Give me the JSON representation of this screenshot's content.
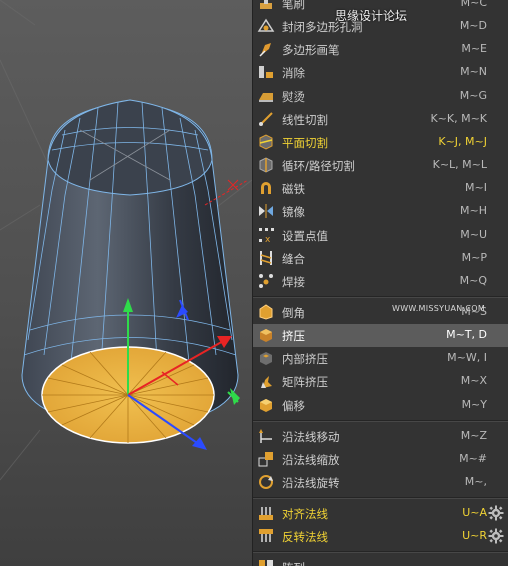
{
  "watermark": {
    "site_name": "思缘设计论坛",
    "url": "WWW.MISSYUAN.COM"
  },
  "menu_groups": [
    [
      {
        "icon": "brush-icon",
        "label": "笔刷",
        "shortcut": "M~C"
      },
      {
        "icon": "close-polygon-hole-icon",
        "label": "封闭多边形孔洞",
        "shortcut": "M~D"
      },
      {
        "icon": "polygon-pen-icon",
        "label": "多边形画笔",
        "shortcut": "M~E"
      },
      {
        "icon": "dissolve-icon",
        "label": "消除",
        "shortcut": "M~N"
      },
      {
        "icon": "iron-icon",
        "label": "熨烫",
        "shortcut": "M~G"
      },
      {
        "icon": "line-cut-icon",
        "label": "线性切割",
        "shortcut": "K~K, M~K"
      },
      {
        "icon": "plane-cut-icon",
        "label": "平面切割",
        "shortcut": "K~J, M~J",
        "yellow": true
      },
      {
        "icon": "loop-path-cut-icon",
        "label": "循环/路径切割",
        "shortcut": "K~L, M~L"
      },
      {
        "icon": "magnet-icon",
        "label": "磁铁",
        "shortcut": "M~I"
      },
      {
        "icon": "mirror-icon",
        "label": "镜像",
        "shortcut": "M~H"
      },
      {
        "icon": "set-point-value-icon",
        "label": "设置点值",
        "shortcut": "M~U"
      },
      {
        "icon": "stitch-sew-icon",
        "label": "缝合",
        "shortcut": "M~P"
      },
      {
        "icon": "weld-icon",
        "label": "焊接",
        "shortcut": "M~Q"
      }
    ],
    [
      {
        "icon": "bevel-icon",
        "label": "倒角",
        "shortcut": "M~S"
      },
      {
        "icon": "extrude-icon",
        "label": "挤压",
        "shortcut": "M~T, D",
        "highlighted": true
      },
      {
        "icon": "extrude-inner-icon",
        "label": "内部挤压",
        "shortcut": "M~W, I"
      },
      {
        "icon": "matrix-extrude-icon",
        "label": "矩阵挤压",
        "shortcut": "M~X"
      },
      {
        "icon": "smooth-shift-icon",
        "label": "偏移",
        "shortcut": "M~Y"
      }
    ],
    [
      {
        "icon": "normal-move-icon",
        "label": "沿法线移动",
        "shortcut": "M~Z"
      },
      {
        "icon": "normal-scale-icon",
        "label": "沿法线缩放",
        "shortcut": "M~#"
      },
      {
        "icon": "normal-rotate-icon",
        "label": "沿法线旋转",
        "shortcut": "M~,"
      }
    ],
    [
      {
        "icon": "align-normals-icon",
        "label": "对齐法线",
        "shortcut": "U~A",
        "yellow": true,
        "gear": true
      },
      {
        "icon": "reverse-normals-icon",
        "label": "反转法线",
        "shortcut": "U~R",
        "yellow": true,
        "gear": true
      }
    ],
    [
      {
        "icon": "array-icon",
        "label": "阵列",
        "shortcut": ""
      }
    ]
  ]
}
